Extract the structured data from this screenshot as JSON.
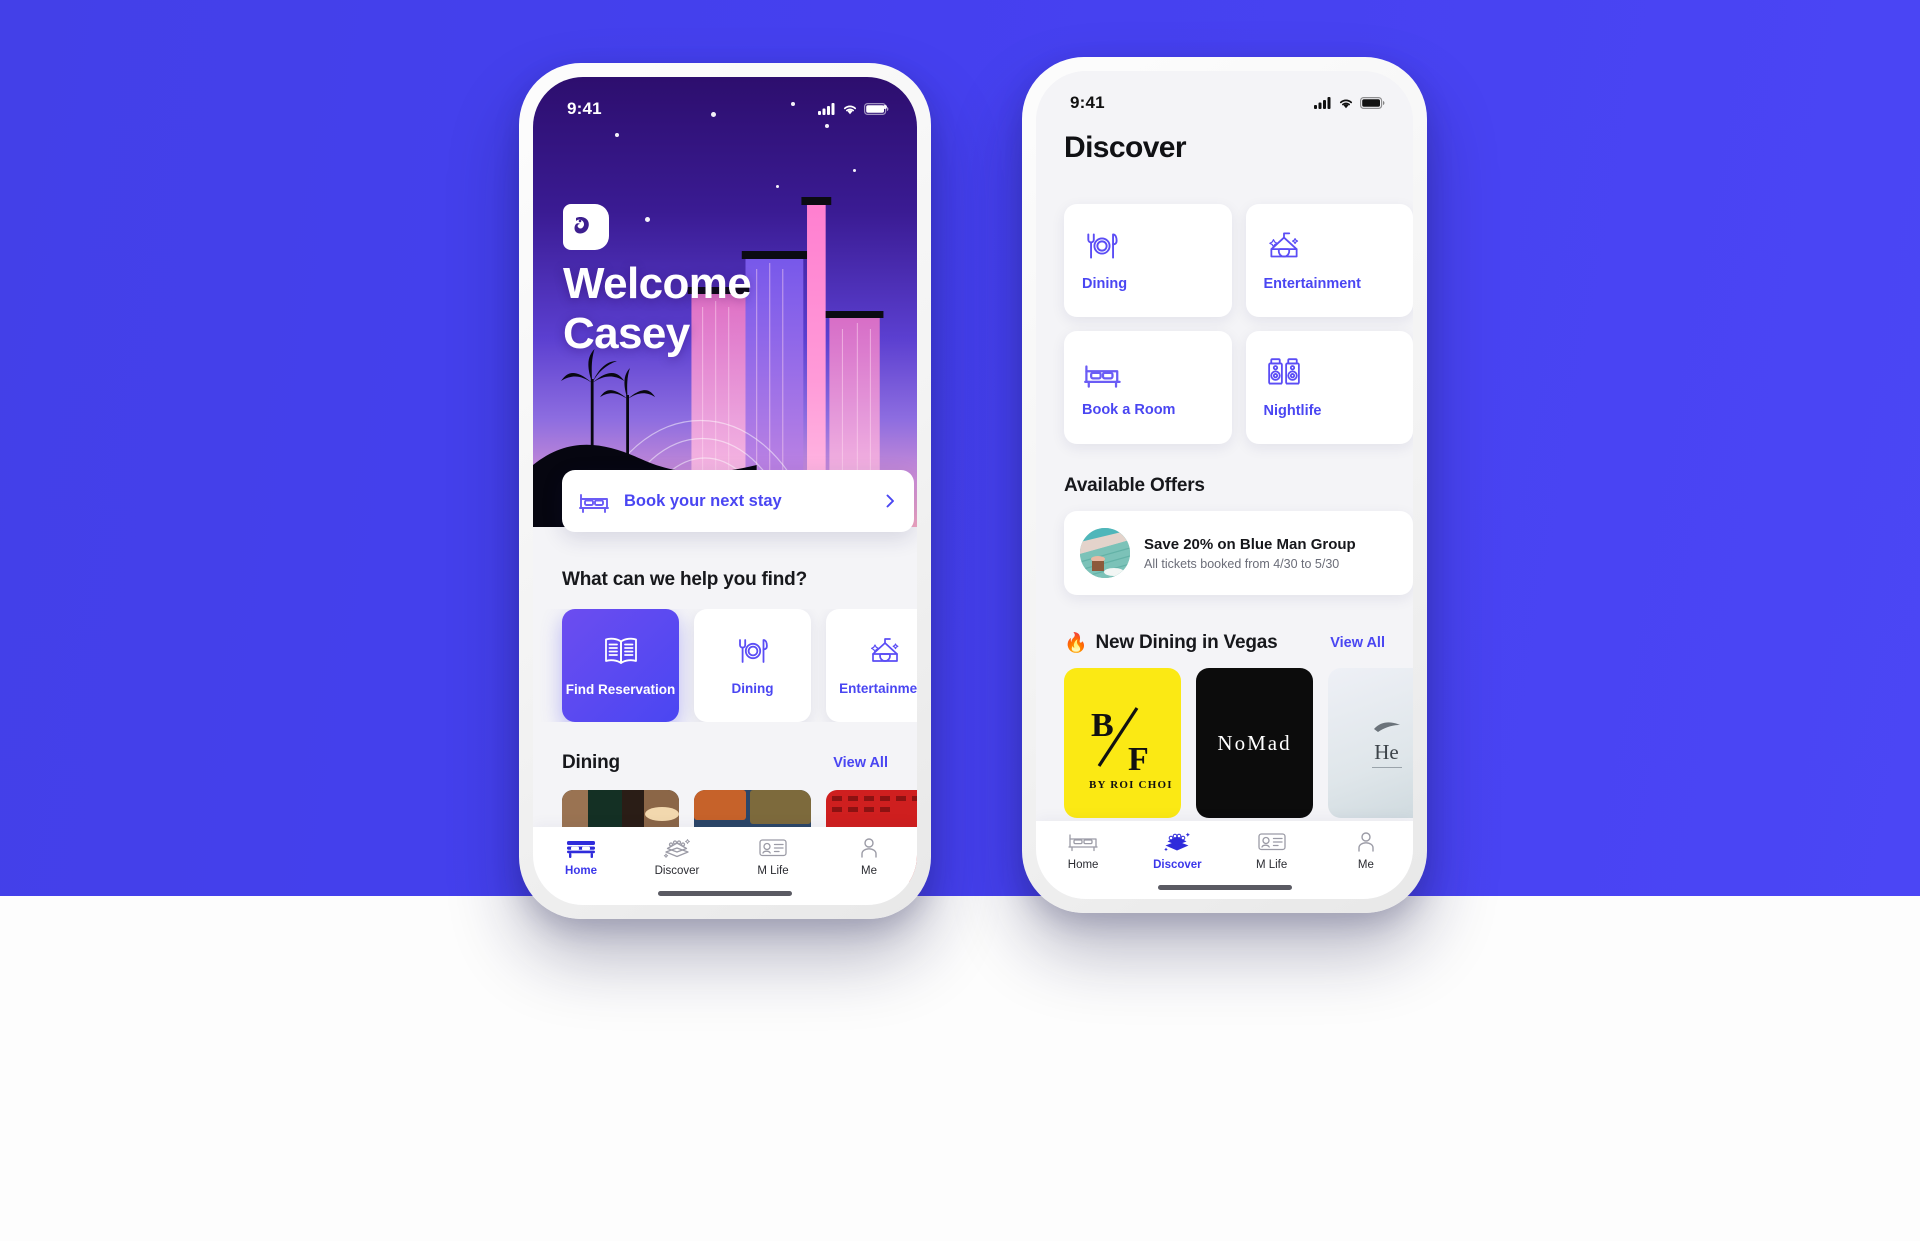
{
  "background": {
    "accent": "#4540ef",
    "lower": "#fdfdfd"
  },
  "phone_one": {
    "status": {
      "time": "9:41",
      "cellular_icon": "signal-bars-icon",
      "wifi_icon": "wifi-icon",
      "battery_icon": "battery-icon"
    },
    "hero": {
      "logo_icon": "mgm-lion-logo-icon",
      "welcome_line1": "Welcome",
      "welcome_line2": "Casey"
    },
    "booking_card": {
      "icon": "bed-icon",
      "label": "Book your next stay",
      "chevron_icon": "chevron-right-icon"
    },
    "help_section": {
      "title": "What can we help you find?"
    },
    "chips": [
      {
        "label": "Find Reservation",
        "icon": "open-book-icon",
        "active": true
      },
      {
        "label": "Dining",
        "icon": "cutlery-plate-icon",
        "active": false
      },
      {
        "label": "Entertainment",
        "icon": "circus-tent-icon",
        "active": false
      }
    ],
    "dining_section": {
      "title": "Dining",
      "view_all": "View All"
    },
    "dining_photos": [
      {
        "name": "restaurant-interior-photo"
      },
      {
        "name": "plated-dishes-photo"
      },
      {
        "name": "red-tray-food-photo"
      }
    ],
    "tabs": [
      {
        "label": "Home",
        "icon": "bed-icon",
        "active": true
      },
      {
        "label": "Discover",
        "icon": "diamond-stack-icon",
        "active": false
      },
      {
        "label": "M Life",
        "icon": "membership-card-icon",
        "active": false
      },
      {
        "label": "Me",
        "icon": "person-icon",
        "active": false
      }
    ]
  },
  "phone_two": {
    "status": {
      "time": "9:41",
      "cellular_icon": "signal-bars-icon",
      "wifi_icon": "wifi-icon",
      "battery_icon": "battery-icon"
    },
    "title": "Discover",
    "grid": [
      {
        "label": "Dining",
        "icon": "cutlery-plate-icon"
      },
      {
        "label": "Entertainment",
        "icon": "circus-tent-icon"
      },
      {
        "label": "Book a Room",
        "icon": "bed-icon"
      },
      {
        "label": "Nightlife",
        "icon": "speakers-icon"
      }
    ],
    "offers_title": "Available Offers",
    "offer": {
      "thumb_icon": "pool-lounge-photo",
      "title": "Save 20% on Blue Man Group",
      "subtitle": "All tickets booked from 4/30 to 5/30"
    },
    "new_dining": {
      "emoji": "🔥",
      "title": "New Dining in Vegas",
      "view_all": "View All"
    },
    "restaurants": [
      {
        "brand_line1": "B",
        "brand_line2": "F",
        "brand_sub": "BY ROI CHOI",
        "style": "yellow"
      },
      {
        "brand_line1": "NoMad",
        "brand_line2": "",
        "brand_sub": "",
        "style": "black"
      },
      {
        "brand_line1": "He",
        "brand_line2": "",
        "brand_sub": "",
        "style": "light"
      }
    ],
    "tabs": [
      {
        "label": "Home",
        "icon": "bed-icon",
        "active": false
      },
      {
        "label": "Discover",
        "icon": "diamond-stack-icon",
        "active": true
      },
      {
        "label": "M Life",
        "icon": "membership-card-icon",
        "active": false
      },
      {
        "label": "Me",
        "icon": "person-icon",
        "active": false
      }
    ]
  }
}
